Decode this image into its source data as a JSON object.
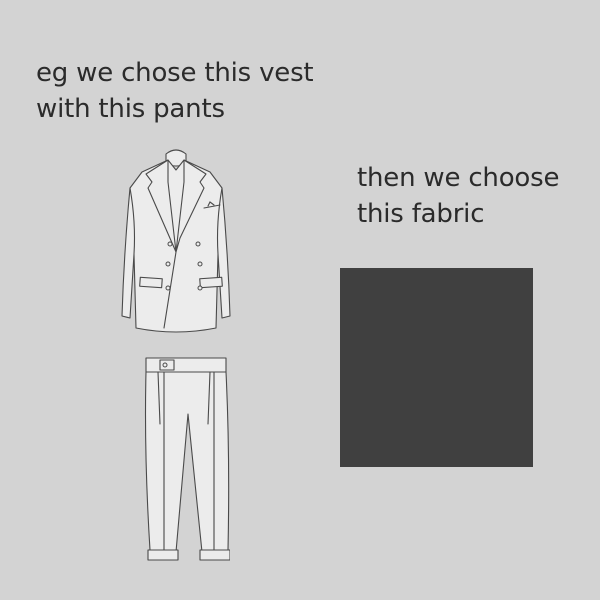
{
  "captions": {
    "left": {
      "line1": "eg we chose this vest",
      "line2": "with this pants"
    },
    "right": {
      "line1": "then we choose",
      "line2": "this fabric"
    }
  },
  "colors": {
    "background": "#d3d3d3",
    "fabric": "#404040",
    "text": "#2b2b2b"
  }
}
